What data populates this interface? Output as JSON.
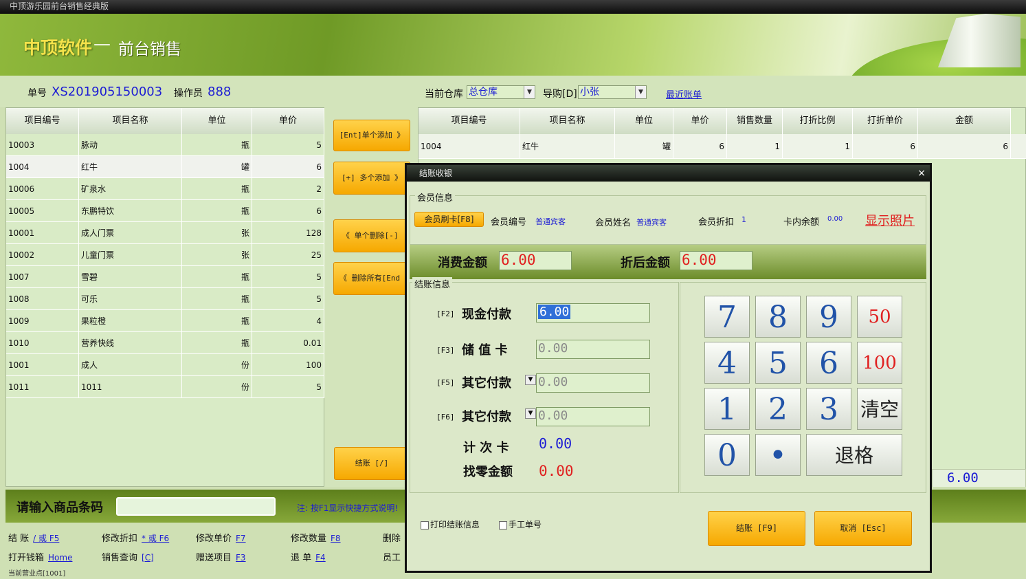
{
  "window": {
    "title": "中顶游乐园前台销售经典版"
  },
  "banner": {
    "brand": "中顶软件",
    "separator": "—",
    "subtitle": "前台销售"
  },
  "header": {
    "order_no_label": "单号",
    "order_no": "XS201905150003",
    "operator_label": "操作员",
    "operator": "888",
    "warehouse_label": "当前仓库",
    "warehouse": "总仓库",
    "guide_label": "导购[D]",
    "guide": "小张",
    "recent_link": "最近账单"
  },
  "left_table": {
    "columns": [
      "项目编号",
      "项目名称",
      "单位",
      "单价"
    ],
    "rows": [
      [
        "10003",
        "脉动",
        "瓶",
        "5"
      ],
      [
        "1004",
        "红牛",
        "罐",
        "6"
      ],
      [
        "10006",
        "矿泉水",
        "瓶",
        "2"
      ],
      [
        "10005",
        "东鹏特饮",
        "瓶",
        "6"
      ],
      [
        "10001",
        "成人门票",
        "张",
        "128"
      ],
      [
        "10002",
        "儿童门票",
        "张",
        "25"
      ],
      [
        "1007",
        "雪碧",
        "瓶",
        "5"
      ],
      [
        "1008",
        "可乐",
        "瓶",
        "5"
      ],
      [
        "1009",
        "果粒橙",
        "瓶",
        "4"
      ],
      [
        "1010",
        "营养快线",
        "瓶",
        "0.01"
      ],
      [
        "1001",
        "成人",
        "份",
        "100"
      ],
      [
        "1011",
        "1011",
        "份",
        "5"
      ]
    ]
  },
  "mid_buttons": {
    "add_one": "[Ent]单个添加 》",
    "add_many": "[+] 多个添加 》",
    "del_one": "《  单个删除[-]",
    "del_all": "《  删除所有[End",
    "checkout": "结账 [/]"
  },
  "right_table": {
    "columns": [
      "项目编号",
      "项目名称",
      "单位",
      "单价",
      "销售数量",
      "打折比例",
      "打折单价",
      "金额"
    ],
    "rows": [
      [
        "1004",
        "红牛",
        "罐",
        "6",
        "1",
        "1",
        "6",
        "6"
      ]
    ],
    "total": "6.00"
  },
  "scan": {
    "label": "请输入商品条码",
    "value": "",
    "note": "注: 按F1显示快捷方式说明!"
  },
  "shortcuts": [
    {
      "label": "结    账",
      "key": "/ 或 F5"
    },
    {
      "label": "修改折扣",
      "key": "* 或 F6"
    },
    {
      "label": "修改单价",
      "key": "F7"
    },
    {
      "label": "修改数量",
      "key": "F8"
    },
    {
      "label": "删除",
      "key": ""
    },
    {
      "label": "打开钱箱",
      "key": "Home"
    },
    {
      "label": "销售查询",
      "key": "[C]"
    },
    {
      "label": "赠送项目",
      "key": "F3"
    },
    {
      "label": "退    单",
      "key": "F4"
    },
    {
      "label": "员工",
      "key": ""
    }
  ],
  "status": {
    "text": "当前营业点[1001]"
  },
  "dialog": {
    "title": "结账收银",
    "close": "×",
    "member_section": "会员信息",
    "swipe_btn": "会员刷卡[F8]",
    "member_no_label": "会员编号",
    "member_no": "普通宾客",
    "member_name_label": "会员姓名",
    "member_name": "普通宾客",
    "member_disc_label": "会员折扣",
    "member_disc": "1",
    "balance_label": "卡内余额",
    "balance": "0.00",
    "photo_link": "显示照片",
    "consume_label": "消费金额",
    "consume": "6.00",
    "after_label": "折后金额",
    "after": "6.00",
    "pay_section": "结账信息",
    "cash_key": "[F2]",
    "cash_label": "现金付款",
    "cash": "6.00",
    "card_key": "[F3]",
    "card_label": "储 值 卡",
    "card": "0.00",
    "other1_key": "[F5]",
    "other1_label": "其它付款",
    "other1": "0.00",
    "other2_key": "[F6]",
    "other2_label": "其它付款",
    "other2": "0.00",
    "count_label": "计 次 卡",
    "count": "0.00",
    "change_label": "找零金额",
    "change": "0.00",
    "keypad": [
      "7",
      "8",
      "9",
      "50",
      "4",
      "5",
      "6",
      "100",
      "1",
      "2",
      "3",
      "清空",
      "0",
      "•",
      "退格"
    ],
    "print_check": "打印结账信息",
    "manual_check": "手工单号",
    "ok_btn": "结账 [F9]",
    "cancel_btn": "取消 [Esc]"
  }
}
